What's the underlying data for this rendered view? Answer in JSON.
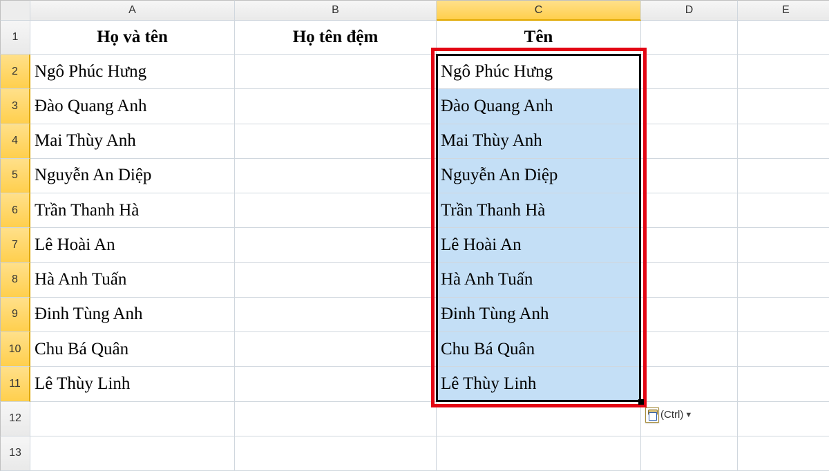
{
  "columns": [
    "A",
    "B",
    "C",
    "D",
    "E"
  ],
  "active_column_index": 2,
  "rows_visible": [
    1,
    2,
    3,
    4,
    5,
    6,
    7,
    8,
    9,
    10,
    11,
    12,
    13
  ],
  "active_rows": [
    2,
    3,
    4,
    5,
    6,
    7,
    8,
    9,
    10,
    11
  ],
  "headers": {
    "A": "Họ và tên",
    "B": "Họ tên đệm",
    "C": "Tên"
  },
  "data_A": [
    "Ngô Phúc Hưng",
    "Đào Quang Anh",
    "Mai Thùy Anh",
    "Nguyễn An Diệp",
    "Trần Thanh Hà",
    "Lê Hoài An",
    "Hà Anh Tuấn",
    "Đinh Tùng Anh",
    "Chu Bá Quân",
    "Lê Thùy Linh"
  ],
  "data_C": [
    "Ngô Phúc Hưng",
    "Đào Quang Anh",
    "Mai Thùy Anh",
    "Nguyễn An Diệp",
    "Trần Thanh Hà",
    "Lê Hoài An",
    "Hà Anh Tuấn",
    "Đinh Tùng Anh",
    "Chu Bá Quân",
    "Lê Thùy Linh"
  ],
  "selection": {
    "range": "C2:C11",
    "active_cell": "C2"
  },
  "smarttag": {
    "label": "(Ctrl)"
  }
}
